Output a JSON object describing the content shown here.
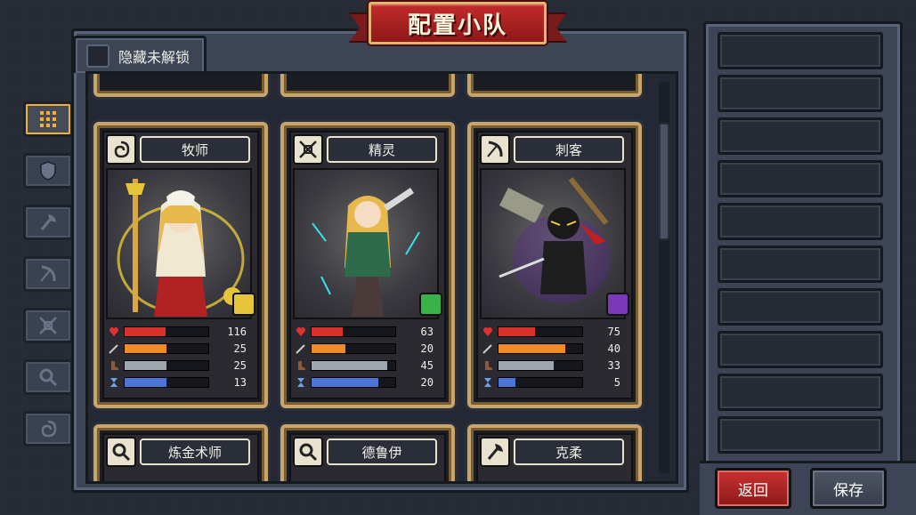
{
  "title": "配置小队",
  "hide_locked_label": "隐藏未解锁",
  "side_tabs": [
    {
      "icon": "grid-icon",
      "active": true
    },
    {
      "icon": "shield-icon",
      "active": false
    },
    {
      "icon": "axe-icon",
      "active": false
    },
    {
      "icon": "bow-icon",
      "active": false
    },
    {
      "icon": "crossed-arrows-icon",
      "active": false
    },
    {
      "icon": "magnifier-icon",
      "active": false
    },
    {
      "icon": "swirl-icon",
      "active": false
    }
  ],
  "cards": [
    {
      "name": "牧师",
      "class_icon": "swirl-icon",
      "skill_color": "#e6c53a",
      "stats": [
        {
          "icon": "heart-icon",
          "value": "116",
          "fill": 0.49,
          "color": "#d9312b"
        },
        {
          "icon": "sword-icon",
          "value": "25",
          "fill": 0.5,
          "color": "#f08a24"
        },
        {
          "icon": "boot-icon",
          "value": "25",
          "fill": 0.5,
          "color": "#9fa6ad"
        },
        {
          "icon": "hourglass-icon",
          "value": "13",
          "fill": 0.5,
          "color": "#4d74d6"
        }
      ]
    },
    {
      "name": "精灵",
      "class_icon": "crossed-arrows-icon",
      "skill_color": "#39b24a",
      "stats": [
        {
          "icon": "heart-icon",
          "value": "63",
          "fill": 0.37,
          "color": "#d9312b"
        },
        {
          "icon": "sword-icon",
          "value": "20",
          "fill": 0.4,
          "color": "#f08a24"
        },
        {
          "icon": "boot-icon",
          "value": "45",
          "fill": 0.9,
          "color": "#9fa6ad"
        },
        {
          "icon": "hourglass-icon",
          "value": "20",
          "fill": 0.8,
          "color": "#4d74d6"
        }
      ]
    },
    {
      "name": "刺客",
      "class_icon": "bow-icon",
      "skill_color": "#7a39b8",
      "stats": [
        {
          "icon": "heart-icon",
          "value": "75",
          "fill": 0.44,
          "color": "#d9312b"
        },
        {
          "icon": "sword-icon",
          "value": "40",
          "fill": 0.8,
          "color": "#f08a24"
        },
        {
          "icon": "boot-icon",
          "value": "33",
          "fill": 0.66,
          "color": "#9fa6ad"
        },
        {
          "icon": "hourglass-icon",
          "value": "5",
          "fill": 0.2,
          "color": "#4d74d6"
        }
      ]
    }
  ],
  "bottom_cards": [
    {
      "name": "炼金术师",
      "class_icon": "magnifier-icon"
    },
    {
      "name": "德鲁伊",
      "class_icon": "magnifier-icon"
    },
    {
      "name": "克柔",
      "class_icon": "axe-icon"
    }
  ],
  "slot_count": 10,
  "buttons": {
    "back": "返回",
    "save": "保存"
  },
  "colors": {
    "accent": "#f3b037",
    "title_red": "#c22b2b",
    "card_gold": "#c8a56b"
  }
}
